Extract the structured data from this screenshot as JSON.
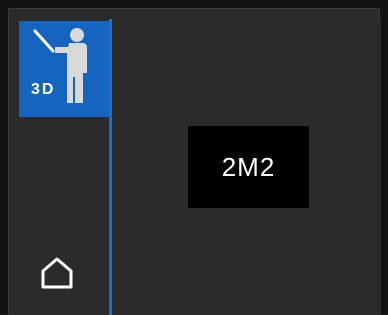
{
  "sidebar": {
    "items": [
      {
        "label": "3D",
        "icon": "person-3d-icon",
        "active": true
      },
      {
        "label": "",
        "icon": "home-icon",
        "active": false
      }
    ]
  },
  "main": {
    "viewer_label": "2M2"
  },
  "colors": {
    "accent": "#1565c0",
    "divider": "#1e6fc7",
    "background": "#2b2b2b",
    "viewer_bg": "#000000",
    "text": "#ffffff"
  }
}
